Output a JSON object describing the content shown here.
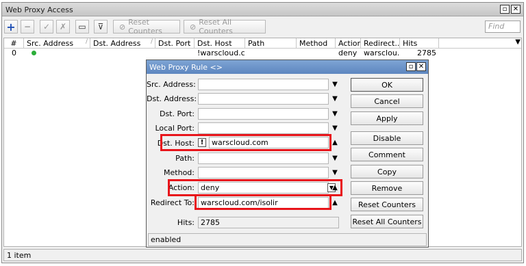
{
  "window": {
    "title": "Web Proxy Access",
    "restore_glyph": "▫",
    "close_glyph": "✕"
  },
  "toolbar": {
    "reset_counters": "Reset Counters",
    "reset_all_counters": "Reset All Counters",
    "find_placeholder": "Find",
    "icons": [
      "plus-icon",
      "minus-icon",
      "check-icon",
      "cross-icon",
      "note-icon",
      "filter-icon"
    ]
  },
  "table": {
    "columns": [
      "#",
      "Src. Address",
      "Dst. Address",
      "Dst. Port",
      "Dst. Host",
      "Path",
      "Method",
      "Action",
      "Redirect...",
      "Hits"
    ],
    "rows": [
      {
        "num": "0",
        "src": "",
        "dst": "",
        "port": "",
        "host": "!warscloud.c...",
        "path": "",
        "method": "",
        "action": "deny",
        "redirect": "warsclou...",
        "hits": "2785"
      }
    ]
  },
  "status": {
    "items": "1 item"
  },
  "dialog": {
    "title": "Web Proxy Rule <>",
    "labels": {
      "src": "Src. Address:",
      "dst": "Dst. Address:",
      "dst_port": "Dst. Port:",
      "local_port": "Local Port:",
      "dst_host": "Dst. Host:",
      "path": "Path:",
      "method": "Method:",
      "action": "Action:",
      "redirect": "Redirect To:",
      "hits": "Hits:"
    },
    "values": {
      "dst_host": "warscloud.com",
      "dst_host_not": "!",
      "action": "deny",
      "redirect": "warscloud.com/isolir",
      "hits": "2785"
    },
    "buttons": [
      "OK",
      "Cancel",
      "Apply",
      "Disable",
      "Comment",
      "Copy",
      "Remove",
      "Reset Counters",
      "Reset All Counters"
    ],
    "status": "enabled"
  },
  "colors": {
    "highlight": "#e8141a",
    "dialog_title": "#6a92c9",
    "enabled_dot": "#2cae3a"
  }
}
